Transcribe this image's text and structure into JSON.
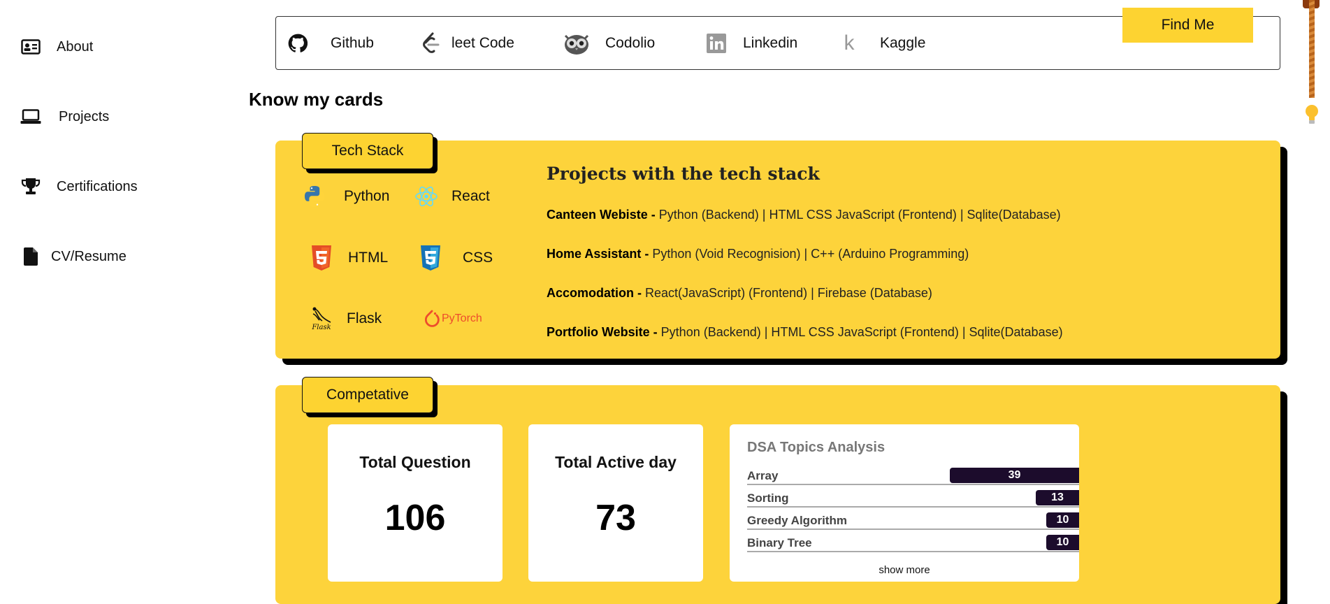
{
  "sidebar": {
    "items": [
      {
        "label": "About",
        "icon": "id-card-icon"
      },
      {
        "label": "Projects",
        "icon": "laptop-icon"
      },
      {
        "label": "Certifications",
        "icon": "trophy-icon"
      },
      {
        "label": "CV/Resume",
        "icon": "file-icon"
      }
    ]
  },
  "social": {
    "links": [
      {
        "label": "Github",
        "icon": "github-icon"
      },
      {
        "label": "leet Code",
        "icon": "leetcode-icon"
      },
      {
        "label": "Codolio",
        "icon": "owl-icon"
      },
      {
        "label": "Linkedin",
        "icon": "linkedin-icon"
      },
      {
        "label": "Kaggle",
        "icon": "kaggle-icon"
      }
    ],
    "find_me": "Find Me"
  },
  "section_title": "Know my cards",
  "tech": {
    "tag": "Tech Stack",
    "items": [
      {
        "label": "Python",
        "icon": "python-icon"
      },
      {
        "label": "React",
        "icon": "react-icon"
      },
      {
        "label": "HTML",
        "icon": "html5-icon"
      },
      {
        "label": "CSS",
        "icon": "css3-icon"
      },
      {
        "label": "Flask",
        "icon": "flask-icon"
      }
    ],
    "pytorch_logo": "PyTorch",
    "flask_logo_text": "Flask",
    "projects_heading": "Projects with the tech stack",
    "projects": [
      {
        "name": "Canteen Webiste -",
        "desc": " Python (Backend) | HTML CSS JavaScript (Frontend) | Sqlite(Database)"
      },
      {
        "name": "Home Assistant -",
        "desc": " Python (Void Recognision) | C++ (Arduino Programming)"
      },
      {
        "name": "Accomodation -",
        "desc": " React(JavaScript) (Frontend) | Firebase (Database)"
      },
      {
        "name": "Portfolio Website -",
        "desc": " Python (Backend) | HTML CSS JavaScript (Frontend) | Sqlite(Database)"
      }
    ]
  },
  "competative": {
    "tag": "Competative",
    "total_question_label": "Total Question",
    "total_question_value": "106",
    "total_active_label": "Total Active day",
    "total_active_value": "73",
    "dsa": {
      "title": "DSA Topics Analysis",
      "topics": [
        {
          "name": "Array",
          "count": "39",
          "fraction": 0.39
        },
        {
          "name": "Sorting",
          "count": "13",
          "fraction": 0.13
        },
        {
          "name": "Greedy Algorithm",
          "count": "10",
          "fraction": 0.1
        },
        {
          "name": "Binary Tree",
          "count": "10",
          "fraction": 0.1
        }
      ],
      "show_more": "show more"
    }
  },
  "colors": {
    "accent": "#fdd33b",
    "bar": "#1c0c2c"
  }
}
